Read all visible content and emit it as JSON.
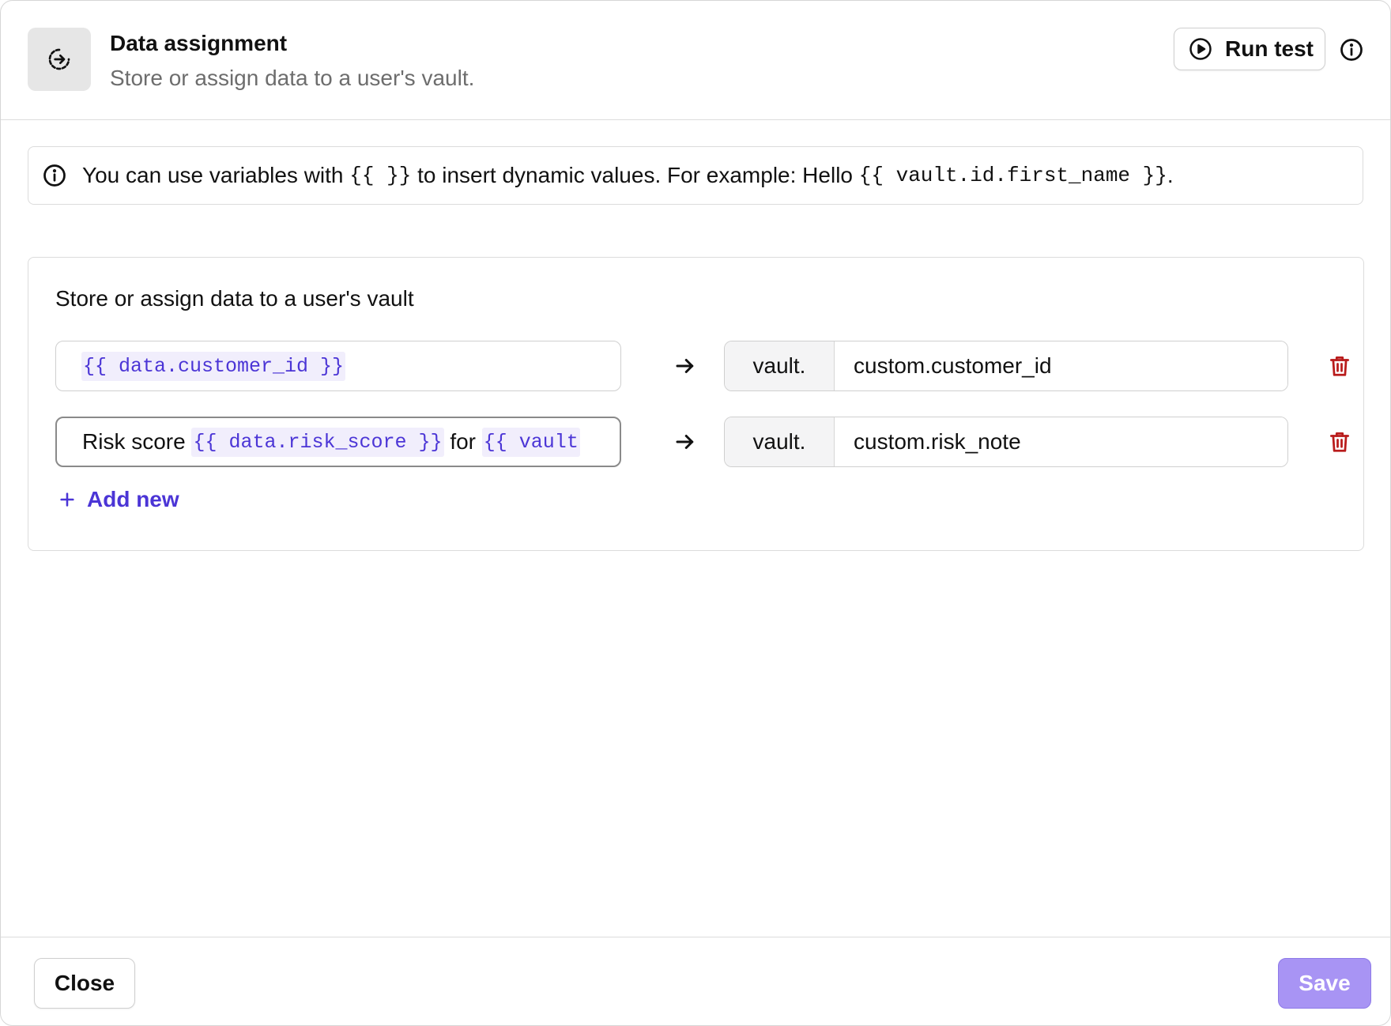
{
  "header": {
    "icon": "arrow-circle-right-icon",
    "title": "Data assignment",
    "subtitle": "Store or assign data to a user's vault.",
    "run_test_label": "Run test"
  },
  "notice": {
    "text_before": "You can use variables with",
    "braces": "{{ }}",
    "text_middle": "to insert dynamic values. For example: Hello",
    "example": "{{ vault.id.first_name }}",
    "text_after": "."
  },
  "card": {
    "title": "Store or assign data to a user's vault",
    "rows": [
      {
        "source_variable": "{{ data.customer_id }}",
        "vault_prefix": "vault.",
        "vault_field": "custom.customer_id"
      },
      {
        "source_text_1": "Risk score",
        "source_variable_1": "{{ data.risk_score }}",
        "source_text_2": "for",
        "source_variable_2": "{{ vault",
        "vault_prefix": "vault.",
        "vault_field": "custom.risk_note"
      }
    ],
    "add_new_label": "Add new"
  },
  "footer": {
    "close_label": "Close",
    "save_label": "Save"
  },
  "colors": {
    "accent": "#4b35d6",
    "variable_bg": "#f1eefc",
    "danger": "#b91c1c",
    "save_bg": "#a894f4"
  }
}
